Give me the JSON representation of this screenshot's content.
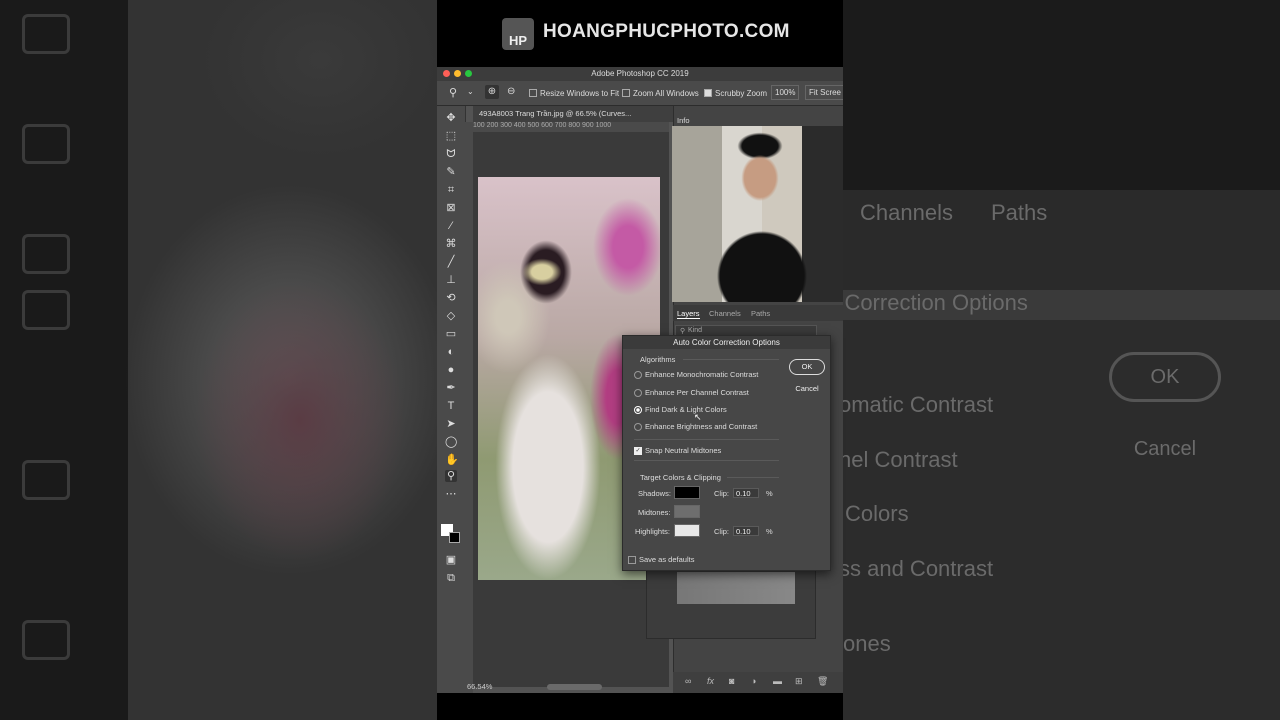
{
  "banner": {
    "logo": "HP",
    "site": "HOANGPHUCPHOTO.COM"
  },
  "window": {
    "title": "Adobe Photoshop CC 2019"
  },
  "options_bar": {
    "resize_windows": "Resize Windows to Fit",
    "zoom_all": "Zoom All Windows",
    "scrubby_zoom": "Scrubby Zoom",
    "zoom_level": "100%",
    "fit_screen": "Fit Scree"
  },
  "document": {
    "tab": "493A8003 Trang Trần.jpg @ 66.5% (Curves...",
    "ruler": "100 200 300 400 500 600 700 800 900 1000",
    "status_zoom": "66.54%"
  },
  "panels": {
    "info_tab": "Info",
    "tabs": [
      "Layers",
      "Channels",
      "Paths"
    ],
    "kind": "Kind"
  },
  "dialog": {
    "title": "Auto Color Correction Options",
    "algorithms_heading": "Algorithms",
    "options": [
      "Enhance Monochromatic Contrast",
      "Enhance Per Channel Contrast",
      "Find Dark & Light Colors",
      "Enhance Brightness and Contrast"
    ],
    "selected_index": 2,
    "snap_neutral": "Snap Neutral Midtones",
    "targets_heading": "Target Colors & Clipping",
    "shadows_label": "Shadows:",
    "midtones_label": "Midtones:",
    "highlights_label": "Highlights:",
    "clip_label": "Clip:",
    "shadows_clip": "0.10",
    "highlights_clip": "0.10",
    "percent": "%",
    "save_defaults": "Save as defaults",
    "ok": "OK",
    "cancel": "Cancel",
    "colors": {
      "shadows": "#000000",
      "midtones": "#6e6e6e",
      "highlights": "#e8e8e8"
    }
  },
  "background_right": {
    "tabs": [
      "Channels",
      "Paths"
    ],
    "title": "r Correction Options",
    "ok": "OK",
    "cancel": "Cancel",
    "lines": [
      "omatic Contrast",
      "nel Contrast",
      "Colors",
      "ss and Contrast",
      "ones"
    ]
  }
}
